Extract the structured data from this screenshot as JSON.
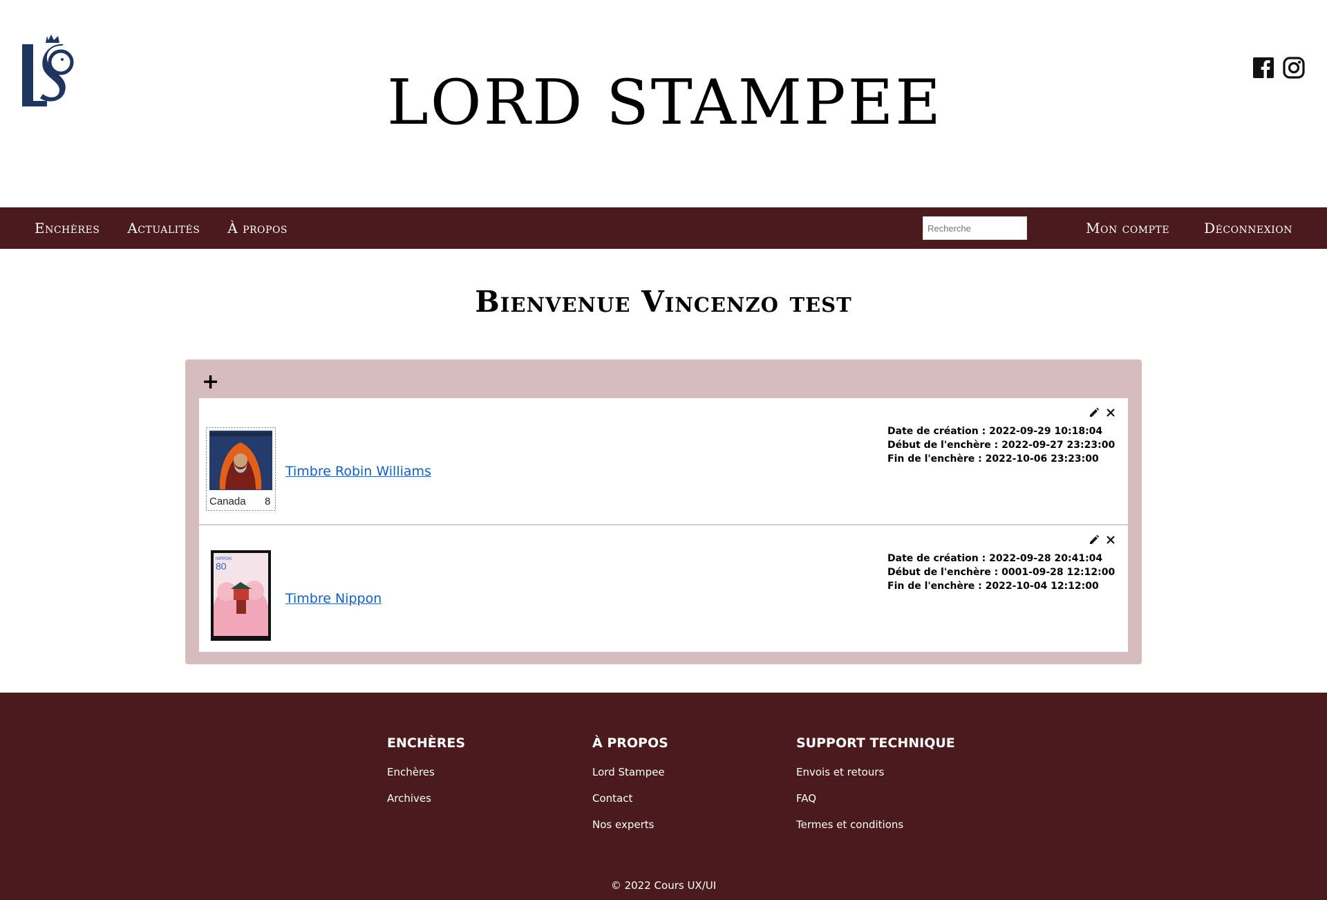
{
  "header": {
    "title": "LORD STAMPEE",
    "logo_text": "LS"
  },
  "nav": {
    "items": [
      {
        "label": "Enchères"
      },
      {
        "label": "Actualités"
      },
      {
        "label": "À propos"
      }
    ],
    "search": {
      "placeholder": "Recherche",
      "value": ""
    },
    "account_label": "Mon compte",
    "logout_label": "Déconnexion"
  },
  "main": {
    "welcome": "Bienvenue Vincenzo test",
    "add_label": "+",
    "auctions": [
      {
        "title": "Timbre Robin Williams",
        "created": "Date de création : 2022-09-29 10:18:04",
        "start": "Début de l'enchère : 2022-09-27 23:23:00",
        "end": "Fin de l'enchère : 2022-10-06 23:23:00",
        "stamp_country": "Canada",
        "stamp_value": "8"
      },
      {
        "title": "Timbre Nippon",
        "created": "Date de création : 2022-09-28 20:41:04",
        "start": "Début de l'enchère : 0001-09-28 12:12:00",
        "end": "Fin de l'enchère : 2022-10-04 12:12:00",
        "stamp_country": "NIPPON",
        "stamp_value": "80"
      }
    ]
  },
  "footer": {
    "columns": [
      {
        "heading": "ENCHÈRES",
        "links": [
          "Enchères",
          "Archives"
        ]
      },
      {
        "heading": "À PROPOS",
        "links": [
          "Lord Stampee",
          "Contact",
          "Nos experts"
        ]
      },
      {
        "heading": "SUPPORT TECHNIQUE",
        "links": [
          "Envois et retours",
          "FAQ",
          "Termes et conditions"
        ]
      }
    ],
    "copyright": "© 2022 Cours UX/UI"
  },
  "colors": {
    "nav_bg": "#4a1a1d",
    "panel_bg": "#d6bcbc",
    "logo": "#1f3560",
    "link": "#1060c0"
  }
}
